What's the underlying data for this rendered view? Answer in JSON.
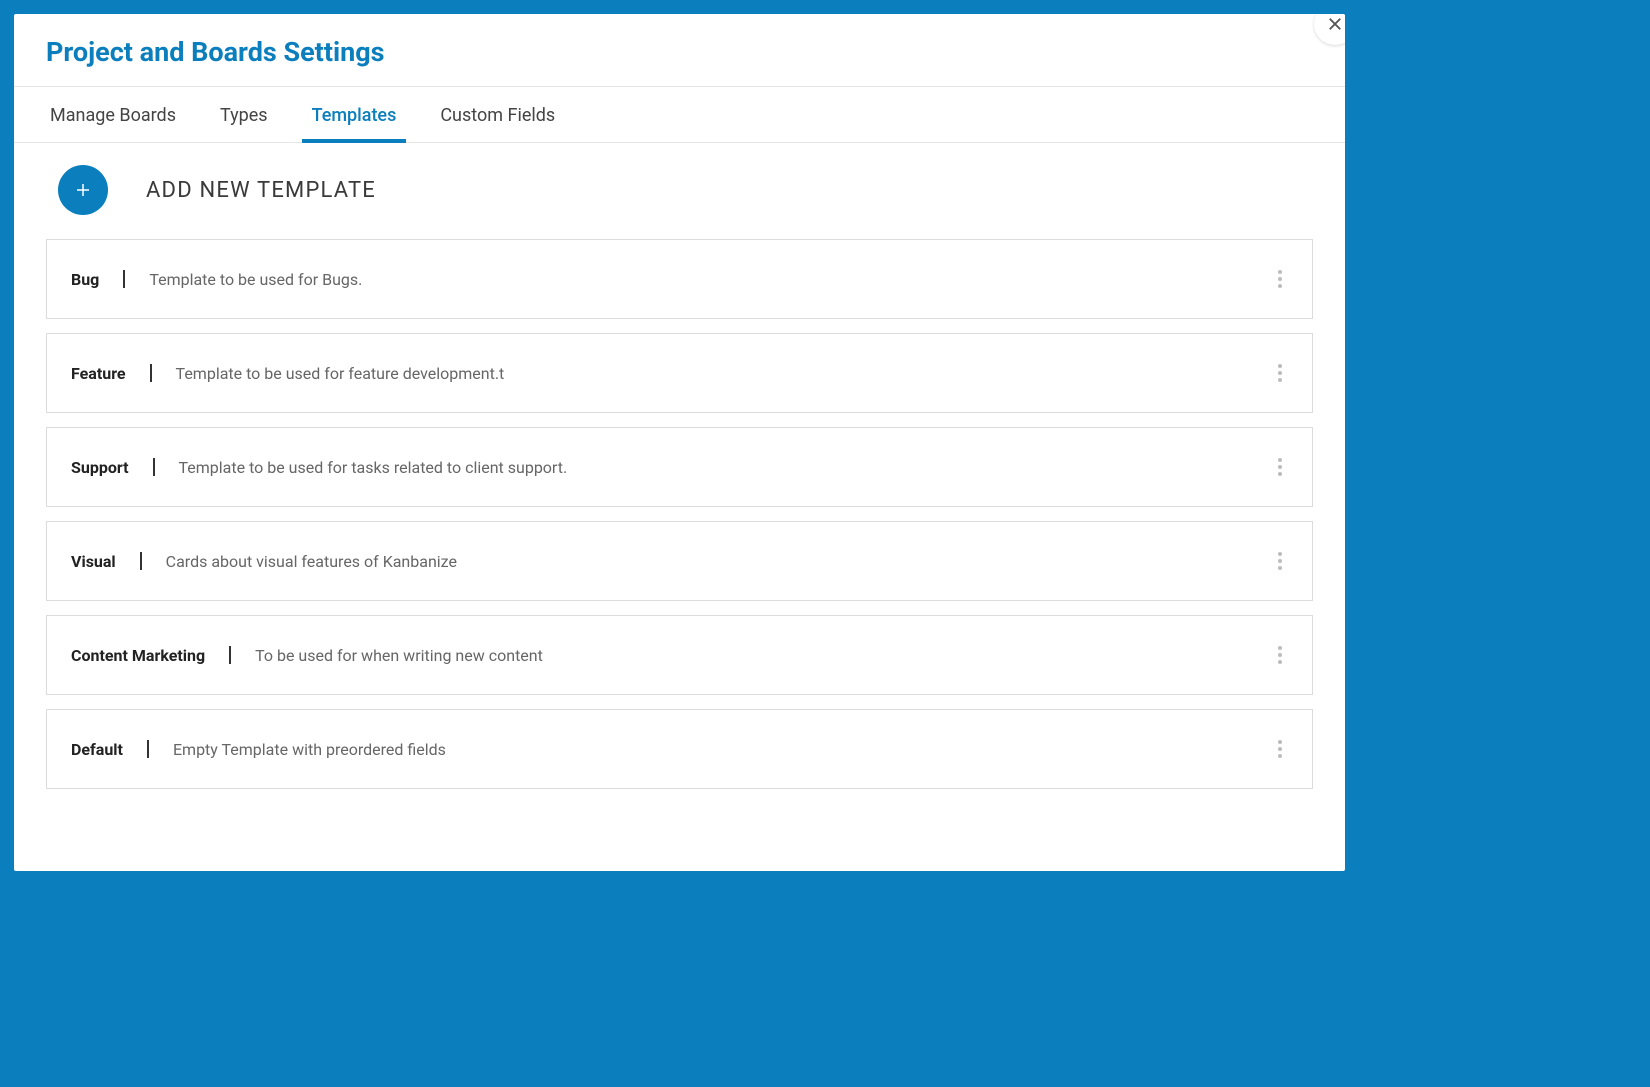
{
  "header": {
    "title": "Project and Boards Settings"
  },
  "tabs": [
    {
      "label": "Manage Boards",
      "active": false
    },
    {
      "label": "Types",
      "active": false
    },
    {
      "label": "Templates",
      "active": true
    },
    {
      "label": "Custom Fields",
      "active": false
    }
  ],
  "addButton": {
    "label": "ADD NEW TEMPLATE"
  },
  "templates": [
    {
      "name": "Bug",
      "description": "Template to be used for Bugs."
    },
    {
      "name": "Feature",
      "description": "Template to be used for feature development.t"
    },
    {
      "name": "Support",
      "description": "Template to be used for tasks related to client support."
    },
    {
      "name": "Visual",
      "description": "Cards about visual features of Kanbanize"
    },
    {
      "name": "Content Marketing",
      "description": "To be used for when writing new content"
    },
    {
      "name": "Default",
      "description": "Empty Template with preordered fields"
    }
  ]
}
